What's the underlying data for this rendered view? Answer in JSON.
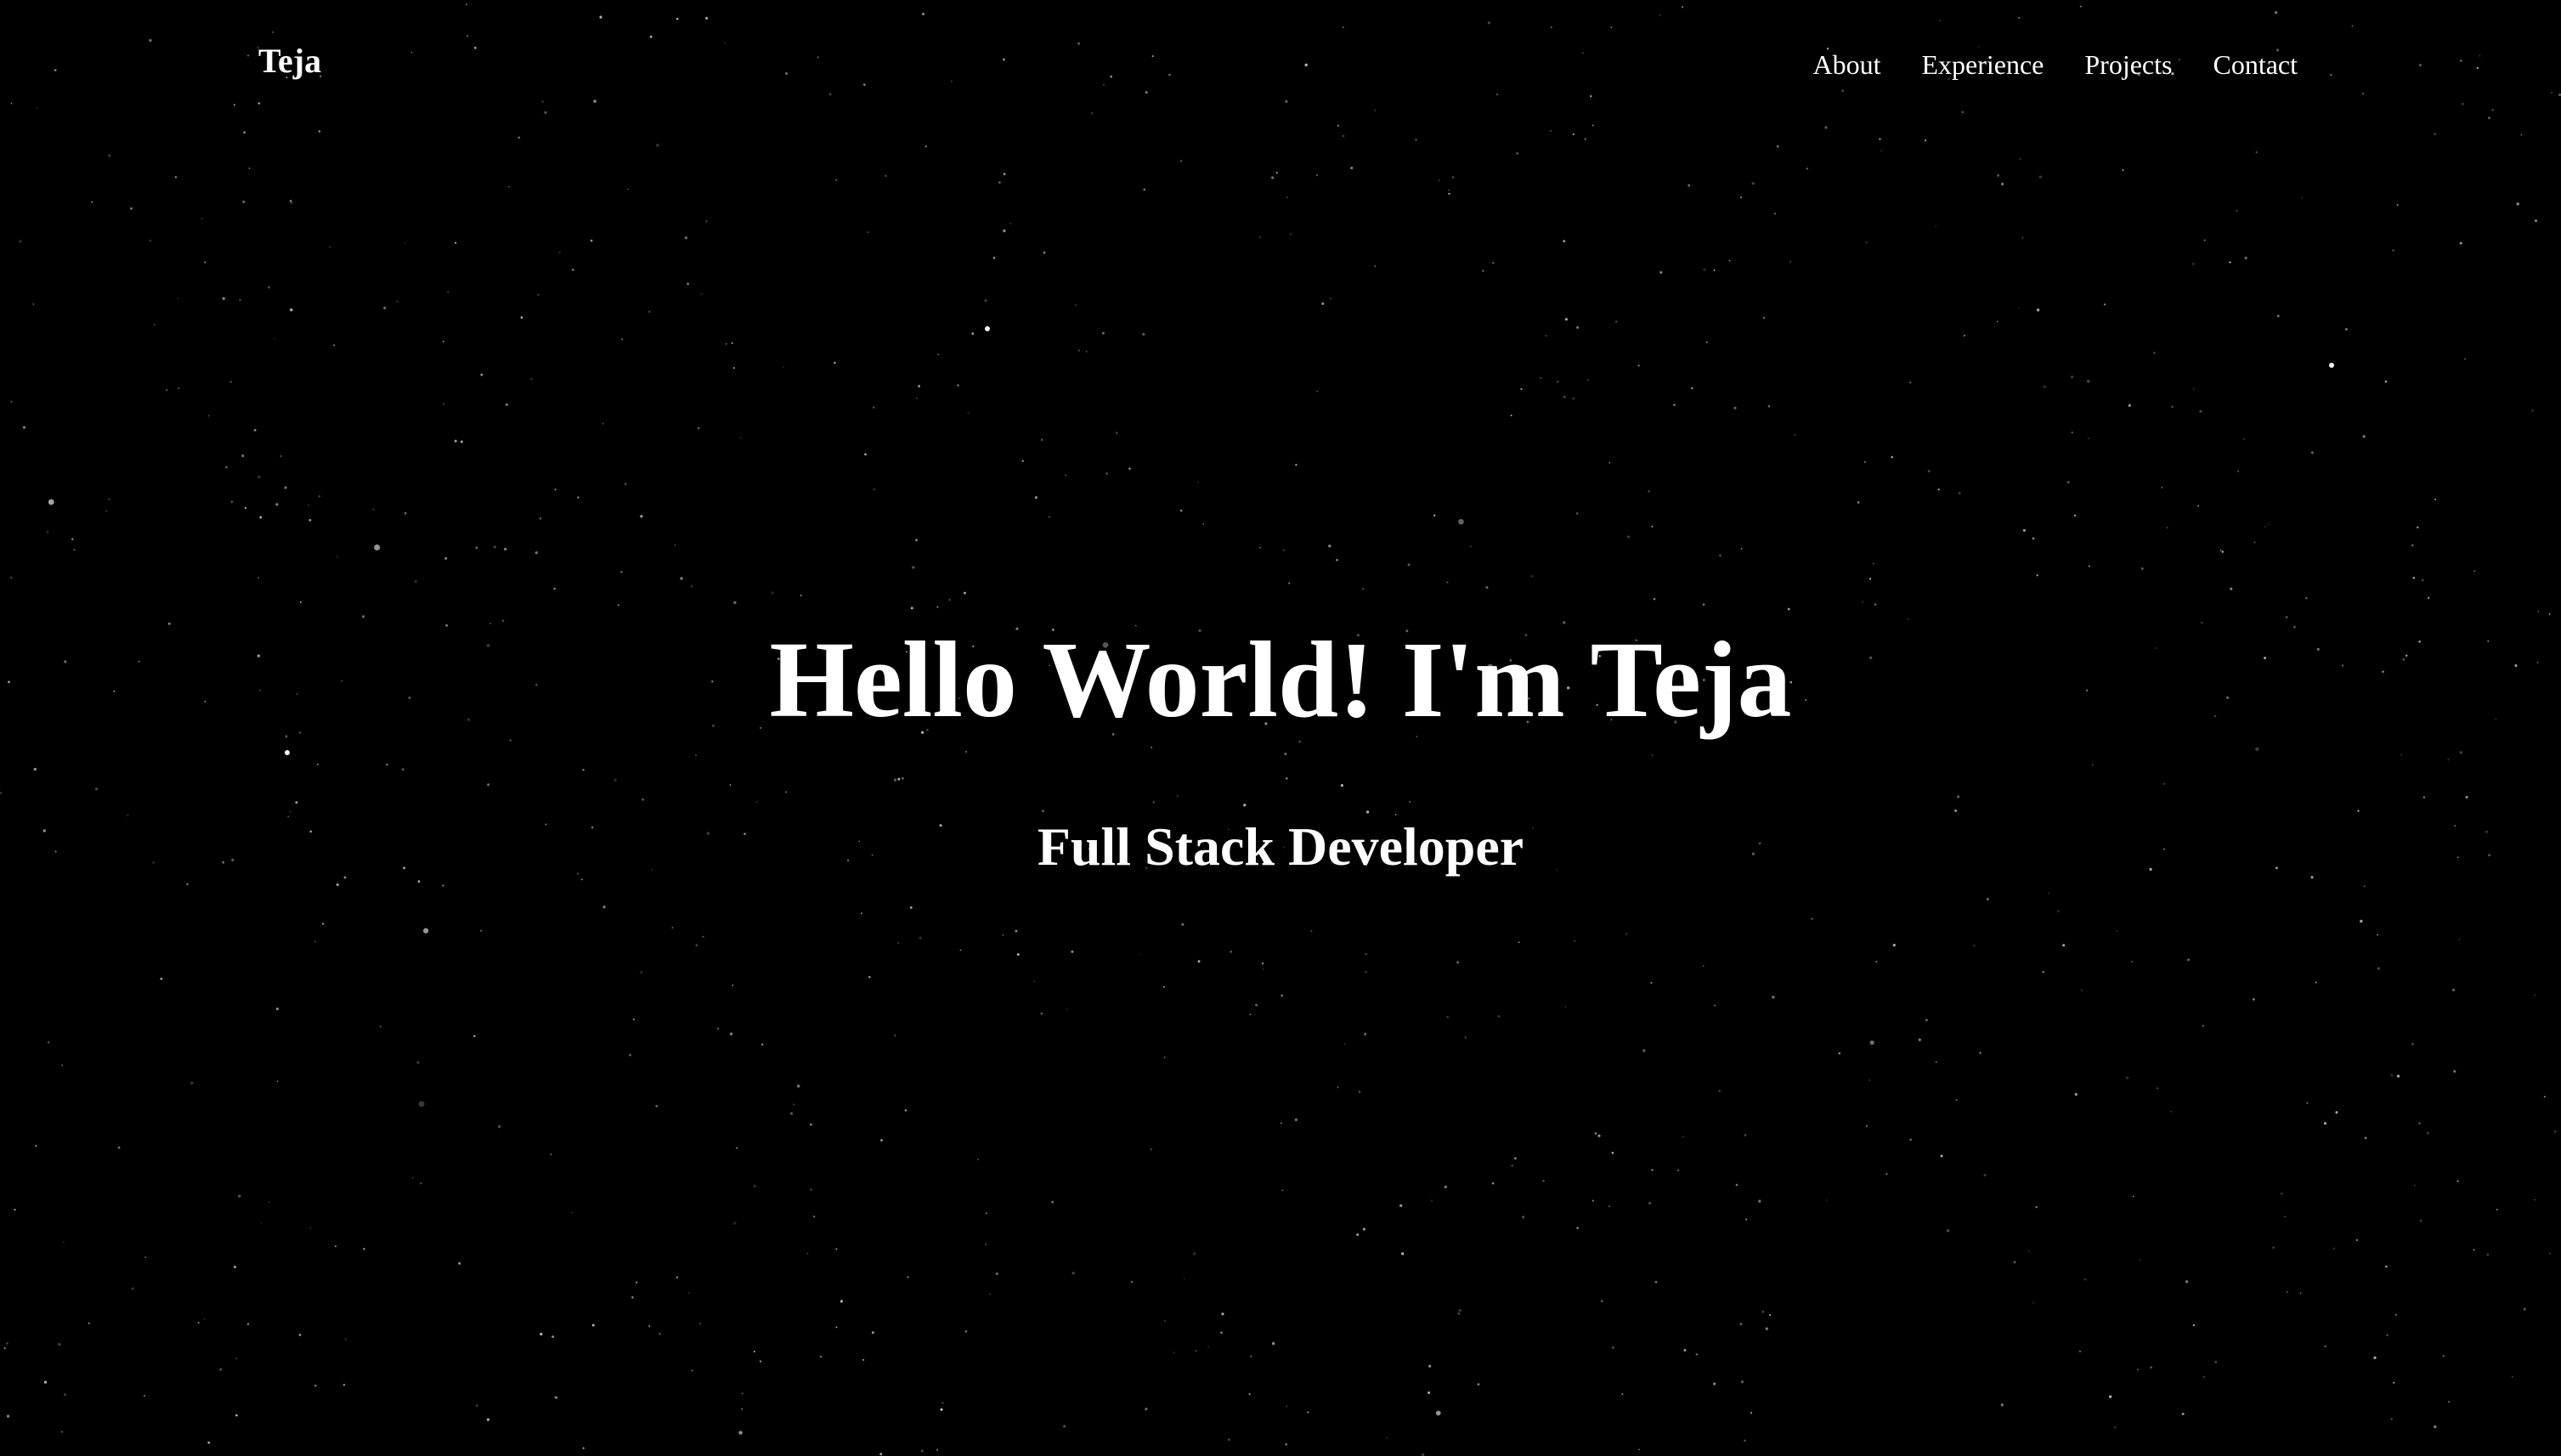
{
  "nav": {
    "brand": "Teja",
    "links": [
      "About",
      "Experience",
      "Projects",
      "Contact"
    ]
  },
  "hero": {
    "title": "Hello World! I'm Teja",
    "subtitle": "Full Stack Developer"
  },
  "colors": {
    "background": "#000000",
    "text": "#ffffff",
    "stars": "#ffffff"
  }
}
